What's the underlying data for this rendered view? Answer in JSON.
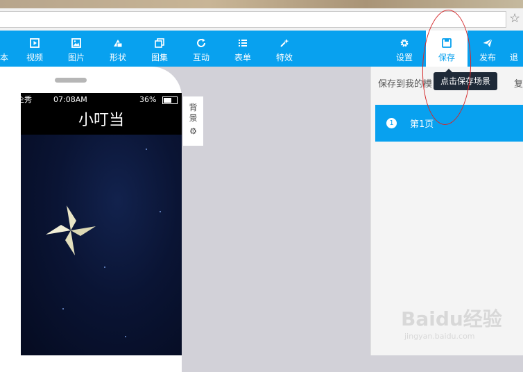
{
  "toolbar": {
    "items": [
      {
        "label": "视频",
        "icon": "play-icon"
      },
      {
        "label": "图片",
        "icon": "image-icon"
      },
      {
        "label": "形状",
        "icon": "shape-icon"
      },
      {
        "label": "图集",
        "icon": "gallery-icon"
      },
      {
        "label": "互动",
        "icon": "refresh-icon"
      },
      {
        "label": "表单",
        "icon": "list-icon"
      },
      {
        "label": "特效",
        "icon": "sparkle-icon"
      },
      {
        "label": "设置",
        "icon": "gear-icon"
      },
      {
        "label": "保存",
        "icon": "save-icon"
      },
      {
        "label": "发布",
        "icon": "send-icon"
      }
    ],
    "accent": "#08a1ef"
  },
  "phone": {
    "carrier": "企秀",
    "time": "07:08AM",
    "battery": "36%",
    "title": "小叮当"
  },
  "background_panel": {
    "label_1": "背",
    "label_2": "景"
  },
  "right_panel": {
    "heading": "保存到我的模",
    "heading_right": "复",
    "page": {
      "number": "1",
      "label": "第1页"
    }
  },
  "tooltip": "点击保存场景",
  "watermark": {
    "main": "Baidu经验",
    "sub": "jingyan.baidu.com"
  }
}
